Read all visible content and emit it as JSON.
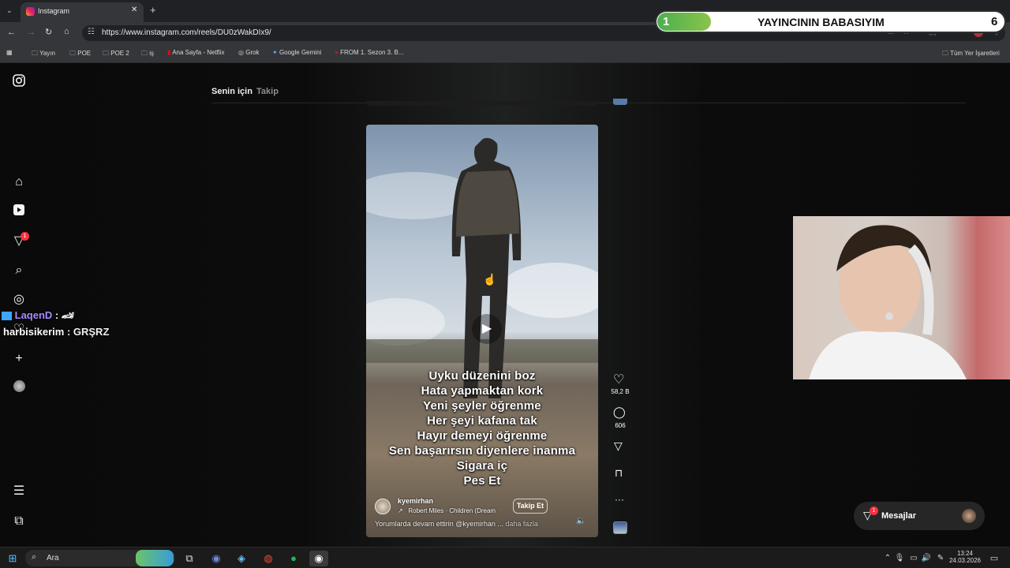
{
  "browser": {
    "tab_title": "Instagram",
    "url": "https://www.instagram.com/reels/DU0zWakDIx9/",
    "bookmarks": [
      "Yayın",
      "POE",
      "POE 2",
      "iş",
      "Ana Sayfa - Netflix",
      "Grok",
      "Google Gemini",
      "FROM 1. Sezon 3. B..."
    ],
    "bookmarks_right": "Tüm Yer İşaretleri"
  },
  "overlay": {
    "left_num": "1",
    "title": "YAYINCININ BABASIYIM",
    "right_num": "6"
  },
  "feed_tabs": {
    "for_you": "Senin için",
    "following": "Takip"
  },
  "nav": {
    "notif_badge": "1"
  },
  "chat": [
    {
      "user": "LaqenD",
      "sep": " : ",
      "msg": "🏎"
    },
    {
      "user": "harbisikerim",
      "sep": " : ",
      "msg": "GRŞRZ"
    }
  ],
  "reel": {
    "caption_lines": [
      "Uyku düzenini boz",
      "Hata yapmaktan kork",
      "Yeni şeyler öğrenme",
      "Her şeyi kafana tak",
      "Hayır demeyi öğrenme",
      "Sen başarırsın diyenlere inanma",
      "Sigara iç",
      "Pes Et"
    ],
    "username": "kyemirhan",
    "audio": "Robert Miles · Children (Dream",
    "follow_label": "Takip Et",
    "comment_prompt": "Yorumlarda devam ettirin @kyemirhan ...",
    "more_label": "daha fazla"
  },
  "actions": {
    "likes": "58,2 B",
    "comments": "606"
  },
  "messages": {
    "label": "Mesajlar",
    "badge": "1"
  },
  "taskbar": {
    "search": "Ara",
    "time": "13:24",
    "date": "24.03.2026"
  }
}
